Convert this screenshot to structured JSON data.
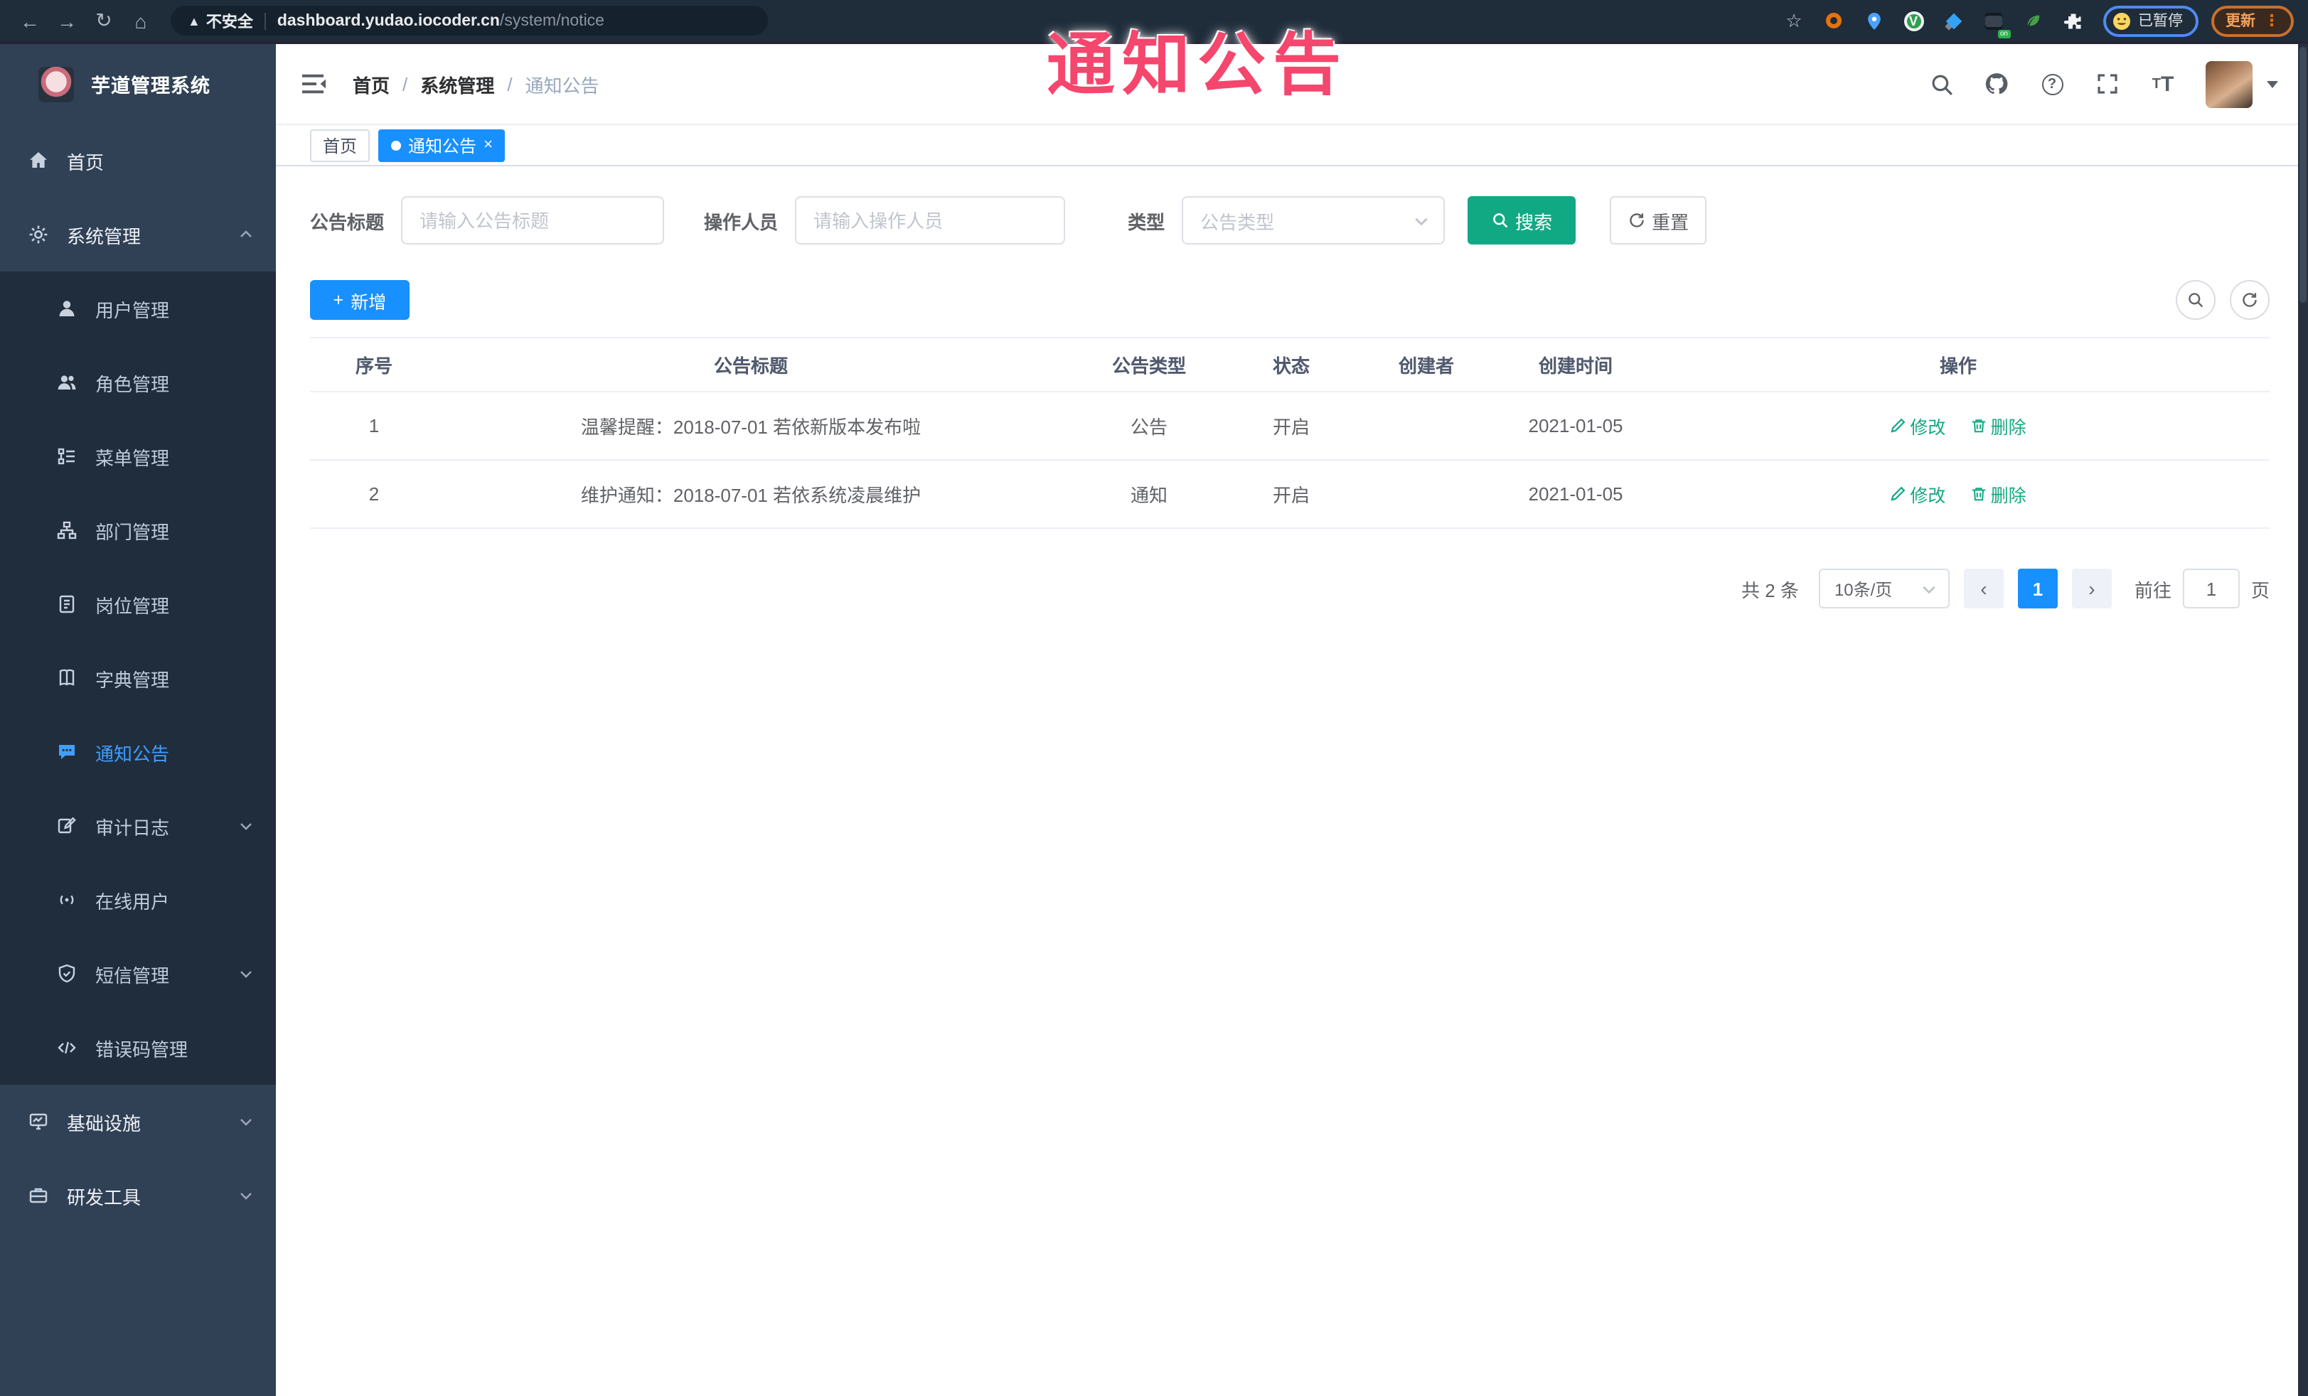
{
  "overlay": {
    "text": "通知公告"
  },
  "browser": {
    "nav_back": "←",
    "nav_forward": "→",
    "nav_reload": "↻",
    "nav_home": "⌂",
    "security_icon": "▲",
    "security_label": "不安全",
    "url_domain": "dashboard.yudao.iocoder.cn",
    "url_path": "/system/notice",
    "star_glyph": "☆",
    "vue_glyph": "V",
    "on_badge": "on",
    "profile_label": "已暂停",
    "update_label": "更新",
    "menu_dots": "⋮"
  },
  "sidebar": {
    "logo_title": "芋道管理系统",
    "items": [
      {
        "icon": "home-icon",
        "label": "首页",
        "level": 1
      },
      {
        "icon": "gear-icon",
        "label": "系统管理",
        "level": 1,
        "chevron": "up"
      },
      {
        "icon": "user-icon",
        "label": "用户管理",
        "level": 2
      },
      {
        "icon": "users-icon",
        "label": "角色管理",
        "level": 2
      },
      {
        "icon": "menu-list-icon",
        "label": "菜单管理",
        "level": 2
      },
      {
        "icon": "org-tree-icon",
        "label": "部门管理",
        "level": 2
      },
      {
        "icon": "post-badge-icon",
        "label": "岗位管理",
        "level": 2
      },
      {
        "icon": "dict-book-icon",
        "label": "字典管理",
        "level": 2
      },
      {
        "icon": "notice-message-icon",
        "label": "通知公告",
        "level": 2,
        "active": true
      },
      {
        "icon": "audit-log-icon",
        "label": "审计日志",
        "level": 2,
        "chevron": "down"
      },
      {
        "icon": "online-users-icon",
        "label": "在线用户",
        "level": 2
      },
      {
        "icon": "sms-shield-icon",
        "label": "短信管理",
        "level": 2,
        "chevron": "down"
      },
      {
        "icon": "error-code-icon",
        "label": "错误码管理",
        "level": 2
      },
      {
        "icon": "infra-monitor-icon",
        "label": "基础设施",
        "level": 1,
        "chevron": "down"
      },
      {
        "icon": "dev-tools-icon",
        "label": "研发工具",
        "level": 1,
        "chevron": "down"
      }
    ]
  },
  "header": {
    "breadcrumb": [
      "首页",
      "系统管理",
      "通知公告"
    ],
    "breadcrumb_sep": "/",
    "help_glyph": "?",
    "font_icon_small": "T",
    "font_icon_large": "T"
  },
  "tabs": [
    {
      "label": "首页"
    },
    {
      "label": "通知公告",
      "close_glyph": "×",
      "active": true
    }
  ],
  "filters": {
    "title_label": "公告标题",
    "title_placeholder": "请输入公告标题",
    "operator_label": "操作人员",
    "operator_placeholder": "请输入操作人员",
    "type_label": "类型",
    "type_placeholder": "公告类型",
    "search_label": "搜索",
    "reset_label": "重置"
  },
  "toolbar": {
    "add_icon": "+",
    "add_label": "新增"
  },
  "table": {
    "columns": [
      "序号",
      "公告标题",
      "公告类型",
      "状态",
      "创建者",
      "创建时间",
      "操作"
    ],
    "rows": [
      {
        "no": "1",
        "title": "温馨提醒：2018-07-01 若依新版本发布啦",
        "type": "公告",
        "status": "开启",
        "creator": "",
        "created": "2021-01-05",
        "edit_label": "修改",
        "delete_label": "删除"
      },
      {
        "no": "2",
        "title": "维护通知：2018-07-01 若依系统凌晨维护",
        "type": "通知",
        "status": "开启",
        "creator": "",
        "created": "2021-01-05",
        "edit_label": "修改",
        "delete_label": "删除"
      }
    ]
  },
  "pagination": {
    "total_label": "共 2 条",
    "page_size_label": "10条/页",
    "prev_glyph": "‹",
    "next_glyph": "›",
    "current_page": "1",
    "goto_label": "前往",
    "goto_value": "1",
    "unit_label": "页"
  },
  "colors": {
    "accent_blue": "#1890ff",
    "accent_teal": "#11a983",
    "sidebar_bg": "#304156",
    "submenu_bg": "#1f2d3d",
    "active_menu": "#409eff",
    "annotation_red": "#f5466d"
  }
}
